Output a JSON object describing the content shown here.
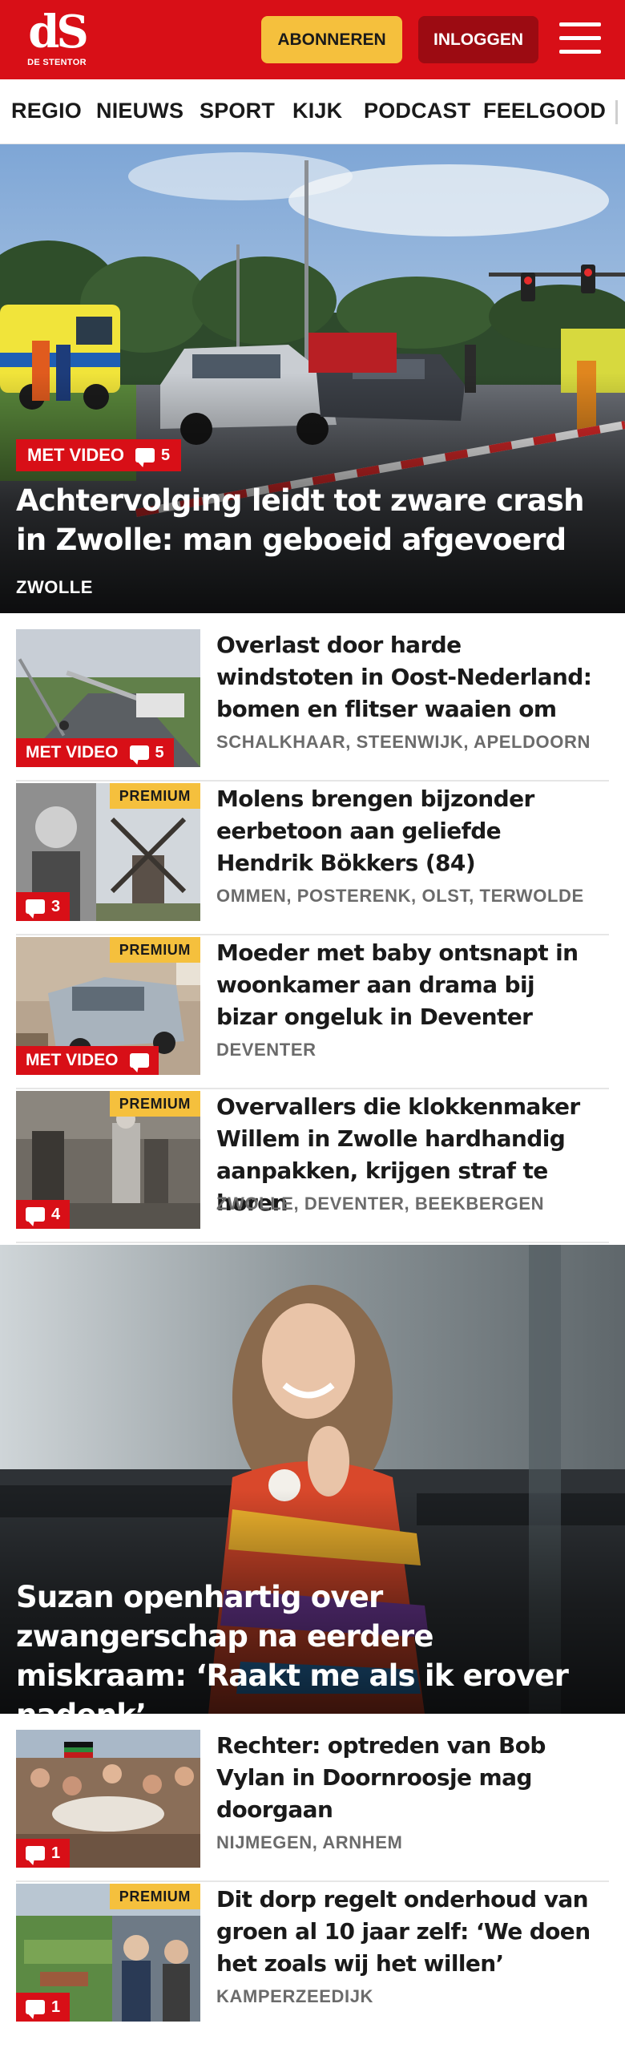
{
  "header": {
    "logo_mark": "dS",
    "logo_sub": "DE STENTOR",
    "subscribe_label": "ABONNEREN",
    "login_label": "INLOGGEN",
    "brand_color": "#d80f17",
    "subscribe_color": "#f5c03d",
    "login_color": "#9c0b12"
  },
  "nav": {
    "items": [
      "REGIO",
      "NIEUWS",
      "SPORT",
      "KIJK",
      "PODCAST",
      "FEELGOOD"
    ]
  },
  "hero": {
    "badge": "MET VIDEO",
    "comments": "5",
    "title": "Achtervolging leidt tot zware crash in Zwolle: man geboeid afgevoerd",
    "location": "ZWOLLE"
  },
  "articles": [
    {
      "badge": "MET VIDEO",
      "comments": "5",
      "premium": "",
      "title": "Overlast door harde windstoten in Oost-Nederland: bomen en flitser waaien om",
      "location": "SCHALKHAAR, STEENWIJK, APELDOORN"
    },
    {
      "badge": "",
      "comments": "3",
      "premium": "PREMIUM",
      "title": "Molens brengen bijzonder eerbetoon aan geliefde Hendrik Bökkers (84)",
      "location": "OMMEN, POSTERENK, OLST, TERWOLDE"
    },
    {
      "badge": "MET VIDEO",
      "comments": "",
      "premium": "PREMIUM",
      "title": "Moeder met baby ontsnapt in woonkamer aan drama bij bizar ongeluk in Deventer",
      "location": "DEVENTER"
    },
    {
      "badge": "",
      "comments": "4",
      "premium": "PREMIUM",
      "title": "Overvallers die klokkenmaker Willem in Zwolle hardhandig aanpakken, krijgen straf te horen",
      "location": "ZWOLLE, DEVENTER, BEEKBERGEN"
    }
  ],
  "feature": {
    "title": "Suzan openhartig over zwangerschap na eerdere miskraam: ‘Raakt me als ik erover nadenk’"
  },
  "articles2": [
    {
      "badge": "",
      "comments": "1",
      "premium": "",
      "title": "Rechter: optreden van Bob Vylan in Doornroosje mag doorgaan",
      "location": "NIJMEGEN, ARNHEM"
    },
    {
      "badge": "",
      "comments": "1",
      "premium": "PREMIUM",
      "title": "Dit dorp regelt onderhoud van groen al 10 jaar zelf: ‘We doen het zoals wij het willen’",
      "location": "KAMPERZEEDIJK"
    }
  ]
}
